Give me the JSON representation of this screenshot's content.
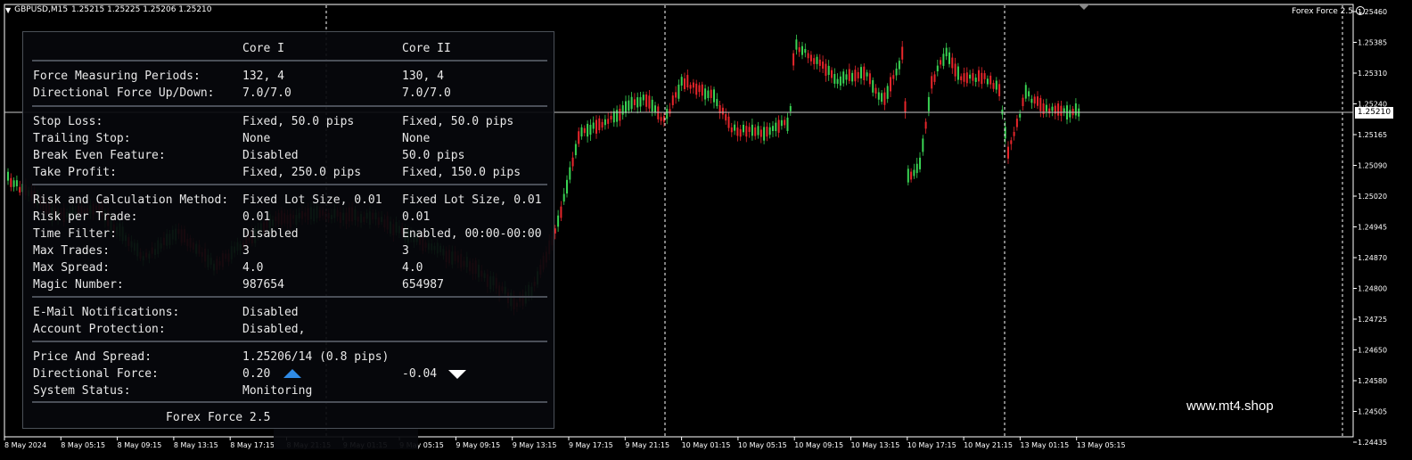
{
  "chart": {
    "symbol": "GBPUSD,M15",
    "ohlc": "1.25215 1.25225 1.25206 1.25210",
    "ea_name": "Forex Force 2.5",
    "smile_icon": "smiley-face-icon",
    "current_price": "1.25210",
    "price_levels": [
      "1.25460",
      "1.25385",
      "1.25310",
      "1.25240",
      "1.25165",
      "1.25090",
      "1.25020",
      "1.24945",
      "1.24870",
      "1.24800",
      "1.24725",
      "1.24650",
      "1.24580",
      "1.24505",
      "1.24435"
    ],
    "time_labels": [
      "8 May 2024",
      "8 May 05:15",
      "8 May 09:15",
      "8 May 13:15",
      "8 May 17:15",
      "8 May 21:15",
      "9 May 01:15",
      "9 May 05:15",
      "9 May 09:15",
      "9 May 13:15",
      "9 May 17:15",
      "9 May 21:15",
      "10 May 01:15",
      "10 May 05:15",
      "10 May 09:15",
      "10 May 13:15",
      "10 May 17:15",
      "10 May 21:15",
      "13 May 01:15",
      "13 May 05:15"
    ],
    "colors": {
      "background": "#000000",
      "bull_candle": "#39d353",
      "bear_candle": "#e8262b",
      "grid": "#ffffff",
      "accent": "#2f8be6"
    },
    "watermark": "www.mt4.shop"
  },
  "panel": {
    "headers": [
      "Core I",
      "Core II"
    ],
    "sections": [
      [
        [
          "Force Measuring Periods:",
          "132, 4",
          "130, 4"
        ],
        [
          "Directional Force Up/Down:",
          "7.0/7.0",
          "7.0/7.0"
        ]
      ],
      [
        [
          "Stop Loss:",
          "Fixed, 50.0 pips",
          "Fixed, 50.0 pips"
        ],
        [
          "Trailing Stop:",
          "None",
          "None"
        ],
        [
          "Break Even Feature:",
          "Disabled",
          "50.0 pips"
        ],
        [
          "Take Profit:",
          "Fixed, 250.0 pips",
          "Fixed, 150.0 pips"
        ]
      ],
      [
        [
          "Risk and Calculation Method:",
          "Fixed Lot Size, 0.01",
          "Fixed Lot Size, 0.01"
        ],
        [
          "Risk per Trade:",
          "0.01",
          "0.01"
        ],
        [
          "Time Filter:",
          "Disabled",
          "Enabled, 00:00-00:00"
        ],
        [
          "Max Trades:",
          "3",
          "3"
        ],
        [
          "Max Spread:",
          "4.0",
          "4.0"
        ],
        [
          "Magic Number:",
          "987654",
          "654987"
        ]
      ],
      [
        [
          "E-Mail Notifications:",
          "Disabled",
          ""
        ],
        [
          "Account Protection:",
          "Disabled,",
          ""
        ]
      ],
      [
        [
          "Price And Spread:",
          "1.25206/14 (0.8 pips)",
          ""
        ],
        [
          "Directional Force:",
          "0.20",
          "-0.04"
        ],
        [
          "System Status:",
          "Monitoring",
          ""
        ]
      ]
    ],
    "force_icons": [
      "arrow-up-icon",
      "arrow-down-icon"
    ],
    "footer": "Forex Force 2.5"
  }
}
